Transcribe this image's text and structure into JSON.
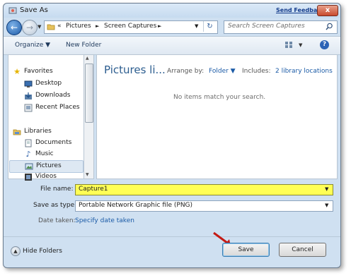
{
  "title": "Save As",
  "feedback": "Send Feedback",
  "close": "x",
  "breadcrumb": {
    "prefix": "«",
    "items": [
      "Pictures",
      "Screen Captures"
    ],
    "sep": "►",
    "dropdown": "▼"
  },
  "search": {
    "placeholder": "Search Screen Captures"
  },
  "toolbar": {
    "organize": "Organize ▼",
    "new_folder": "New Folder"
  },
  "nav": {
    "favorites": "Favorites",
    "desktop": "Desktop",
    "downloads": "Downloads",
    "recent": "Recent Places",
    "libraries": "Libraries",
    "documents": "Documents",
    "music": "Music",
    "pictures": "Pictures",
    "videos": "Videos"
  },
  "content": {
    "heading": "Pictures li...",
    "arrange_label": "Arrange by:",
    "arrange_value": "Folder ▼",
    "includes_label": "Includes:",
    "includes_value": "2 library locations",
    "empty": "No items match your search."
  },
  "form": {
    "filename_label": "File name:",
    "filename_value": "Capture1",
    "type_label": "Save as type:",
    "type_value": "Portable Network Graphic file (PNG)",
    "date_label": "Date taken:",
    "date_link": "Specify date taken"
  },
  "footer": {
    "hide_folders": "Hide Folders",
    "save": "Save",
    "cancel": "Cancel"
  }
}
